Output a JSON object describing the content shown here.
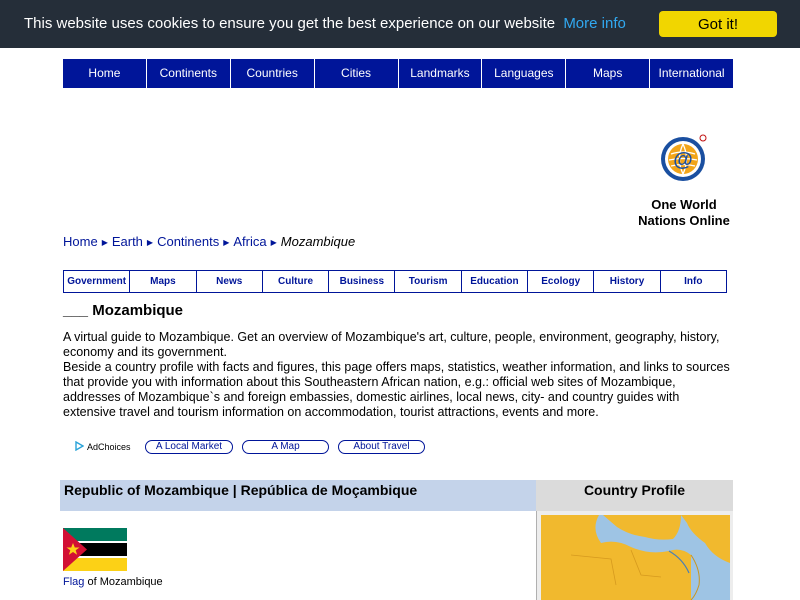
{
  "cookie": {
    "message": "This website uses cookies to ensure you get the best experience on our website",
    "more_info": "More info",
    "button": "Got it!"
  },
  "top_nav": {
    "items": [
      "Home",
      "Continents",
      "Countries",
      "Cities",
      "Landmarks",
      "Languages",
      "Maps",
      "International"
    ]
  },
  "logo": {
    "line1": "One World",
    "line2": "Nations Online",
    "icon": "at-globe-logo"
  },
  "breadcrumb": {
    "links": [
      "Home",
      "Earth",
      "Continents",
      "Africa"
    ],
    "current": "Mozambique"
  },
  "section_nav": {
    "items": [
      "Government",
      "Maps",
      "News",
      "Culture",
      "Business",
      "Tourism",
      "Education",
      "Ecology",
      "History",
      "Info"
    ]
  },
  "title": "___ Mozambique",
  "intro": {
    "p1": "A virtual guide to Mozambique. Get an overview of Mozambique's art, culture, people, environment, geography, history, economy and its government.",
    "p2": "Beside a country profile with facts and figures, this page offers maps, statistics, weather information, and links to sources that provide you with information about this Southeastern African nation, e.g.: official web sites of Mozambique, addresses of Mozambique`s and foreign embassies, domestic airlines, local news, city- and country guides with extensive travel and tourism information on accommodation, tourist attractions, events and more."
  },
  "ads": {
    "adchoices": "AdChoices",
    "buttons": [
      "A Local Market",
      "A Map",
      "About Travel"
    ]
  },
  "country": {
    "header": "Republic of Mozambique | República de Moçambique",
    "profile_header": "Country Profile",
    "flag_link": "Flag",
    "flag_caption_rest": " of Mozambique"
  },
  "colors": {
    "cookie_bg": "#252e39",
    "cookie_button": "#f1d600",
    "cookie_link": "#31a8f0",
    "nav_blue": "#001599",
    "header_blue": "#c4d3ea",
    "header_grey": "#dbdbdb"
  }
}
